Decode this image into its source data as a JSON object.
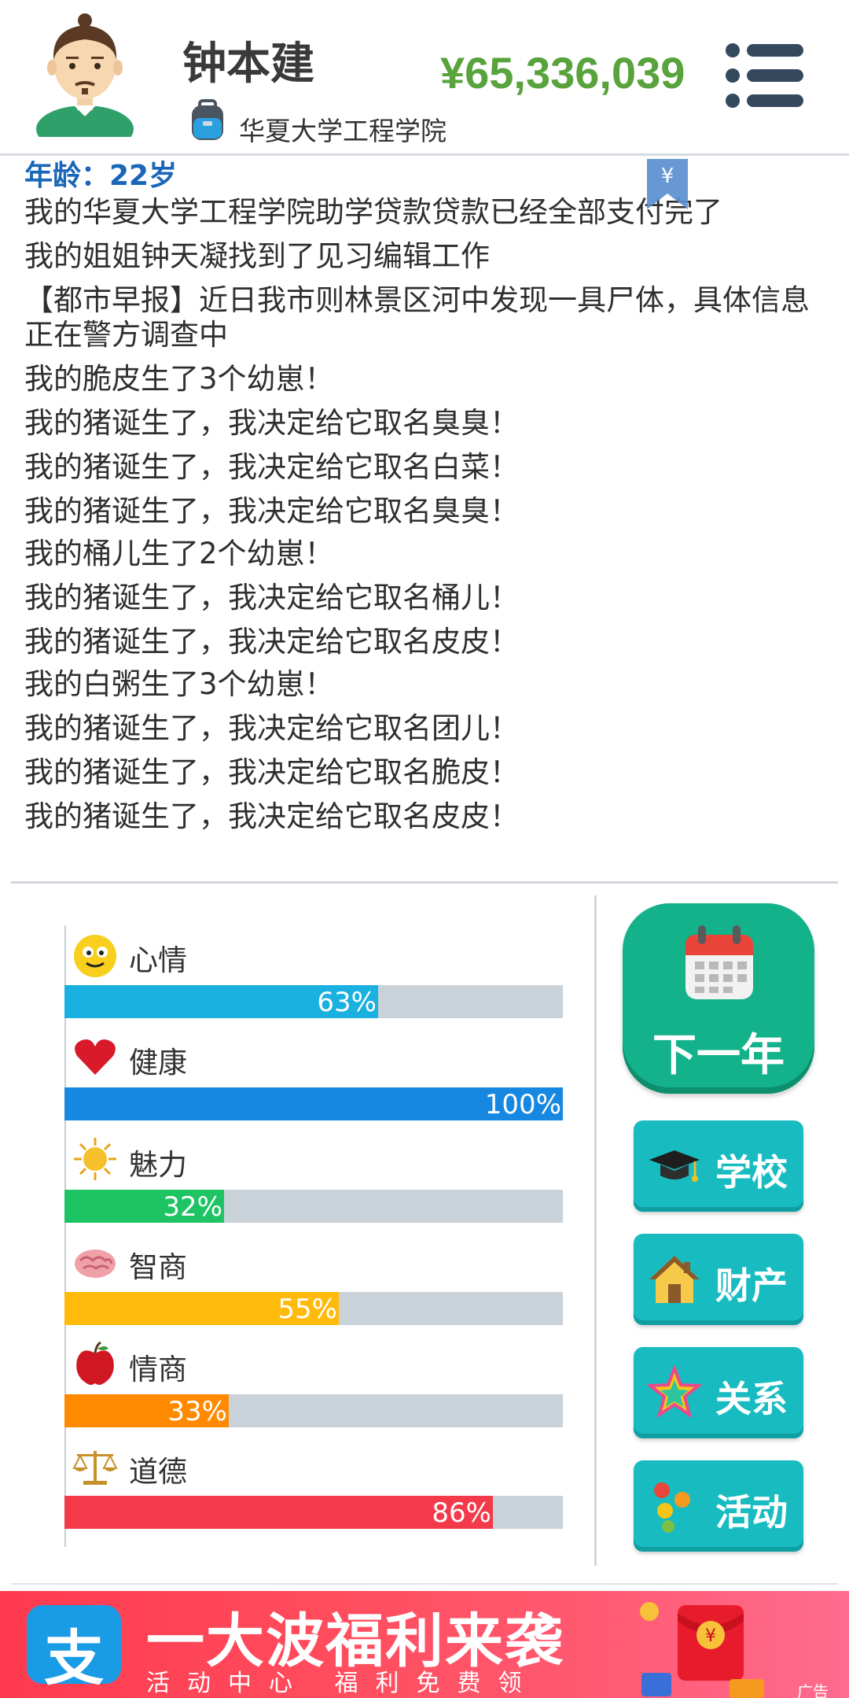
{
  "header": {
    "name": "钟本建",
    "school": "华夏大学工程学院",
    "money": "¥65,336,039",
    "bookmark_symbol": "¥"
  },
  "log": {
    "age_line": "年龄：22岁",
    "lines": [
      "我的华夏大学工程学院助学贷款贷款已经全部支付完了",
      "我的姐姐钟天凝找到了见习编辑工作",
      "【都市早报】近日我市则林景区河中发现一具尸体，具体信息正在警方调查中",
      "我的脆皮生了3个幼崽！",
      "我的猪诞生了，我决定给它取名臭臭！",
      "我的猪诞生了，我决定给它取名白菜！",
      "我的猪诞生了，我决定给它取名臭臭！",
      "我的桶儿生了2个幼崽！",
      "我的猪诞生了，我决定给它取名桶儿！",
      "我的猪诞生了，我决定给它取名皮皮！",
      "我的白粥生了3个幼崽！",
      "我的猪诞生了，我决定给它取名团儿！",
      "我的猪诞生了，我决定给它取名脆皮！",
      "我的猪诞生了，我决定给它取名皮皮！"
    ]
  },
  "stats": [
    {
      "label": "心情",
      "value": 63,
      "text": "63%",
      "color": "#1ab0e0",
      "icon": "smiley-icon"
    },
    {
      "label": "健康",
      "value": 100,
      "text": "100%",
      "color": "#1688e2",
      "icon": "heart-icon"
    },
    {
      "label": "魅力",
      "value": 32,
      "text": "32%",
      "color": "#1ec463",
      "icon": "sun-icon"
    },
    {
      "label": "智商",
      "value": 55,
      "text": "55%",
      "color": "#ffba0a",
      "icon": "brain-icon"
    },
    {
      "label": "情商",
      "value": 33,
      "text": "33%",
      "color": "#ff8a00",
      "icon": "apple-icon"
    },
    {
      "label": "道德",
      "value": 86,
      "text": "86%",
      "color": "#f23a4a",
      "icon": "scales-icon"
    }
  ],
  "actions": {
    "next_year": "下一年",
    "school": "学校",
    "property": "财产",
    "relations": "关系",
    "activities": "活动"
  },
  "ad": {
    "logo_char": "支",
    "headline": "一大波福利来袭",
    "sub": "活动中心 福利免费领",
    "mark": "广告",
    "coin_symbol": "¥"
  }
}
